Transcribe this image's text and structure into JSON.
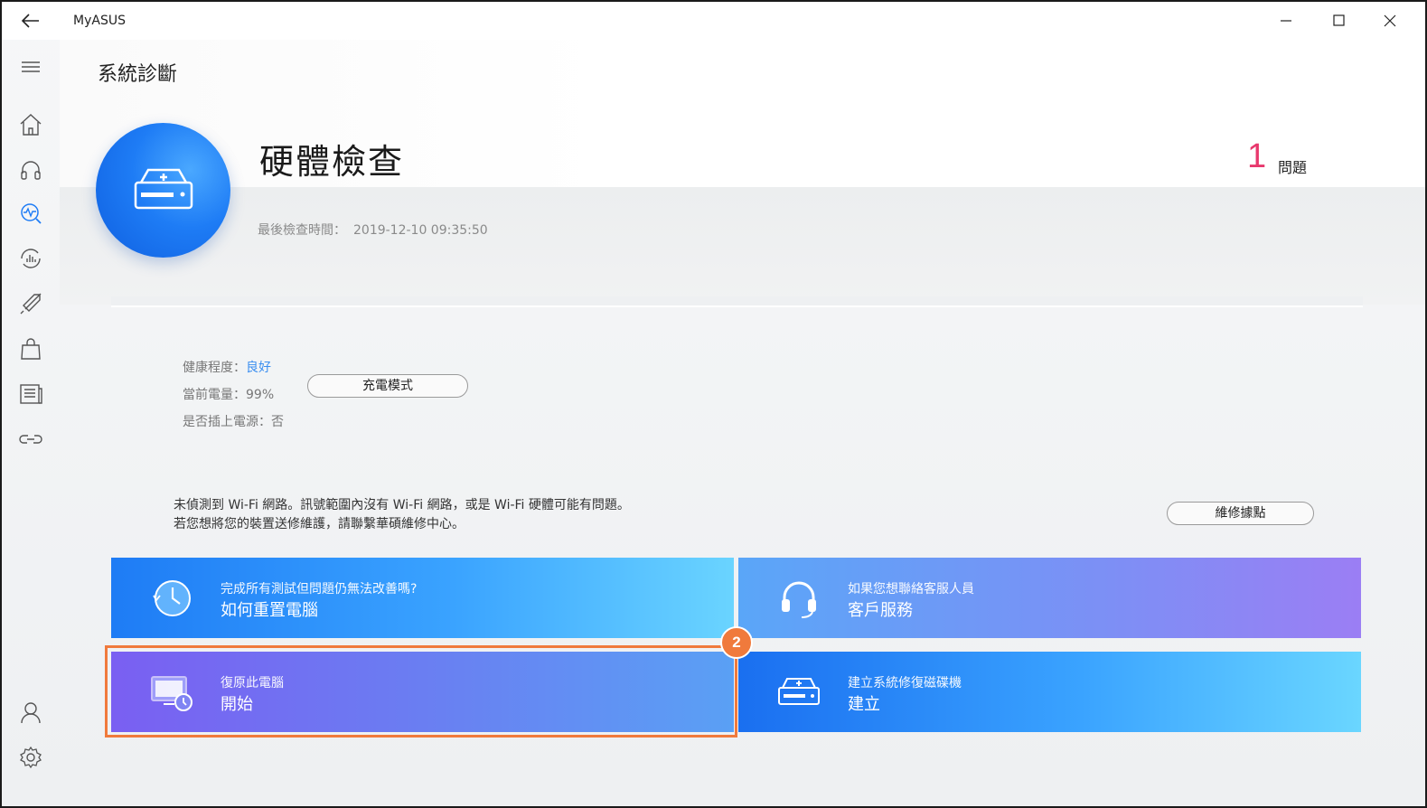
{
  "window": {
    "app_title": "MyASUS"
  },
  "page": {
    "title": "系統診斷"
  },
  "hero": {
    "title": "硬體檢查",
    "issue_count": "1",
    "issue_label": "問題",
    "last_check_label": "最後檢查時間：",
    "last_check_value": "2019-12-10 09:35:50"
  },
  "battery": {
    "health_label": "健康程度：",
    "health_value": "良好",
    "charge_label": "當前電量：99%",
    "plugged_label": "是否插上電源：否",
    "charge_mode_button": "充電模式"
  },
  "message": {
    "line1": "未偵測到 Wi-Fi 網路。訊號範圍內沒有 Wi-Fi 網路，或是 Wi-Fi 硬體可能有問題。",
    "line2": "若您想將您的裝置送修維護，請聯繫華碩維修中心。",
    "service_center_button": "維修據點"
  },
  "cards": [
    {
      "sub": "完成所有測試但問題仍無法改善嗎?",
      "main": "如何重置電腦",
      "icon": "clock-icon"
    },
    {
      "sub": "如果您想聯絡客服人員",
      "main": "客戶服務",
      "icon": "headset-icon"
    },
    {
      "sub": "復原此電腦",
      "main": "開始",
      "icon": "monitor-restore-icon"
    },
    {
      "sub": "建立系統修復磁碟機",
      "main": "建立",
      "icon": "drive-icon"
    }
  ],
  "annotation": {
    "badge": "2"
  },
  "sidebar": {
    "icons": [
      "menu-icon",
      "home-icon",
      "headset-icon",
      "diagnosis-icon",
      "update-icon",
      "rocket-icon",
      "bag-icon",
      "news-icon",
      "link-icon",
      "user-icon",
      "settings-icon"
    ]
  },
  "colors": {
    "accent": "#1e7cf5",
    "issue": "#e8386d",
    "annotation": "#f07a3c",
    "health_good": "#3b8ff0"
  }
}
